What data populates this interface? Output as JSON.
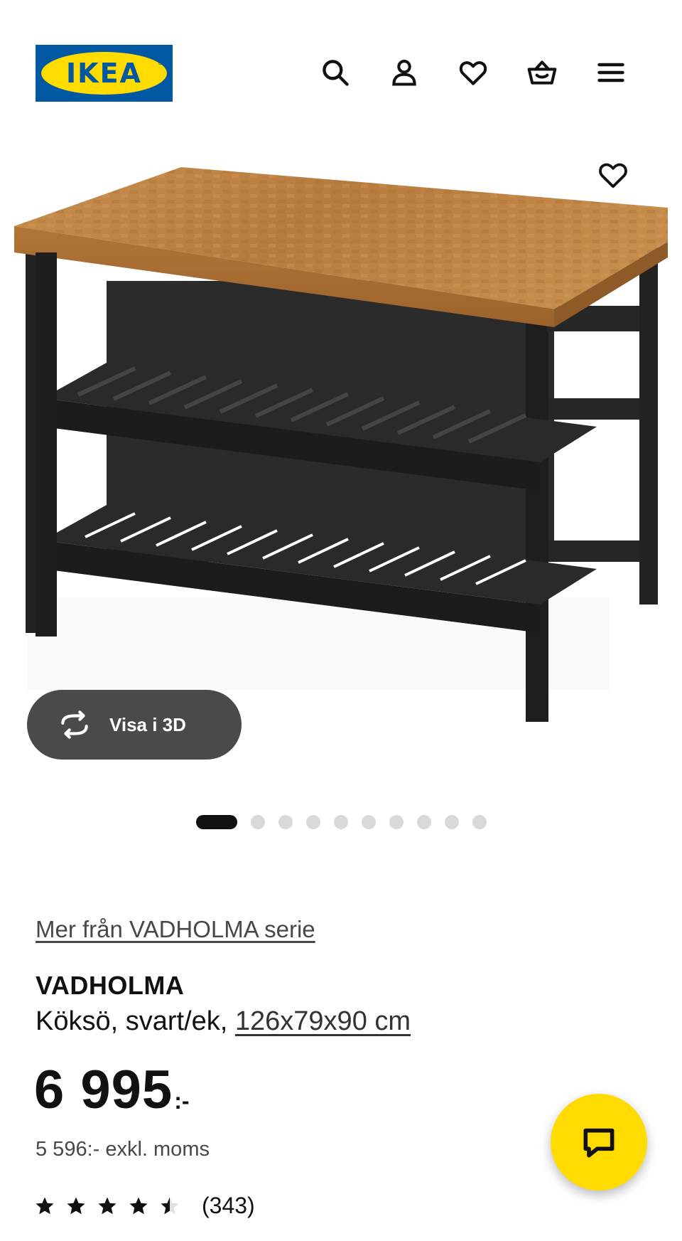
{
  "header": {
    "logo_text": "IKEA",
    "logo_reg": "®",
    "icons": [
      "search-icon",
      "account-icon",
      "favorites-icon",
      "cart-icon",
      "menu-icon"
    ]
  },
  "gallery": {
    "view3d_label": "Visa i 3D",
    "dot_count": 10,
    "active_index": 0
  },
  "product": {
    "series_link": "Mer från VADHOLMA serie",
    "name": "VADHOLMA",
    "description": "Köksö, svart/ek, ",
    "size": "126x79x90 cm",
    "price": "6 995",
    "price_suffix": ":-",
    "price_excl_vat": "5 596:- exkl. moms",
    "rating": 4.5,
    "rating_max": 5,
    "review_count": "(343)"
  },
  "colors": {
    "brand_blue": "#0058a3",
    "brand_yellow": "#ffdb00",
    "view3d_bg": "#4a4a4a"
  }
}
